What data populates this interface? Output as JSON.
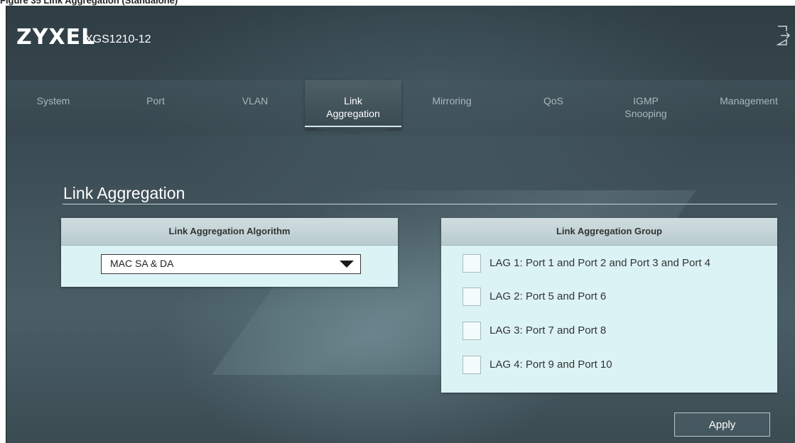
{
  "caption": "Figure 35  Link Aggregation (Standalone)",
  "header": {
    "logo": "ZYXEL",
    "model": "XGS1210-12",
    "logout_icon": "logout-icon"
  },
  "nav": {
    "tabs": [
      {
        "label": "System"
      },
      {
        "label": "Port"
      },
      {
        "label": "VLAN"
      },
      {
        "label": "Link Aggregation",
        "active": true
      },
      {
        "label": "Mirroring"
      },
      {
        "label": "QoS"
      },
      {
        "label": "IGMP Snooping"
      },
      {
        "label": "Management"
      }
    ]
  },
  "page": {
    "title": "Link Aggregation"
  },
  "algorithm": {
    "header": "Link Aggregation Algorithm",
    "selected": "MAC SA & DA"
  },
  "group": {
    "header": "Link Aggregation Group",
    "items": [
      {
        "label": "LAG 1: Port 1 and Port 2 and Port 3 and Port 4",
        "checked": false
      },
      {
        "label": "LAG 2: Port 5 and Port 6",
        "checked": false
      },
      {
        "label": "LAG 3: Port 7 and Port 8",
        "checked": false
      },
      {
        "label": "LAG 4: Port 9 and Port 10",
        "checked": false
      }
    ]
  },
  "actions": {
    "apply_label": "Apply"
  },
  "colors": {
    "panel_bg": "#dcf3f5",
    "panel_header": "#c3d3d7",
    "background": "#3c4c54",
    "text_light": "#ffffff"
  }
}
